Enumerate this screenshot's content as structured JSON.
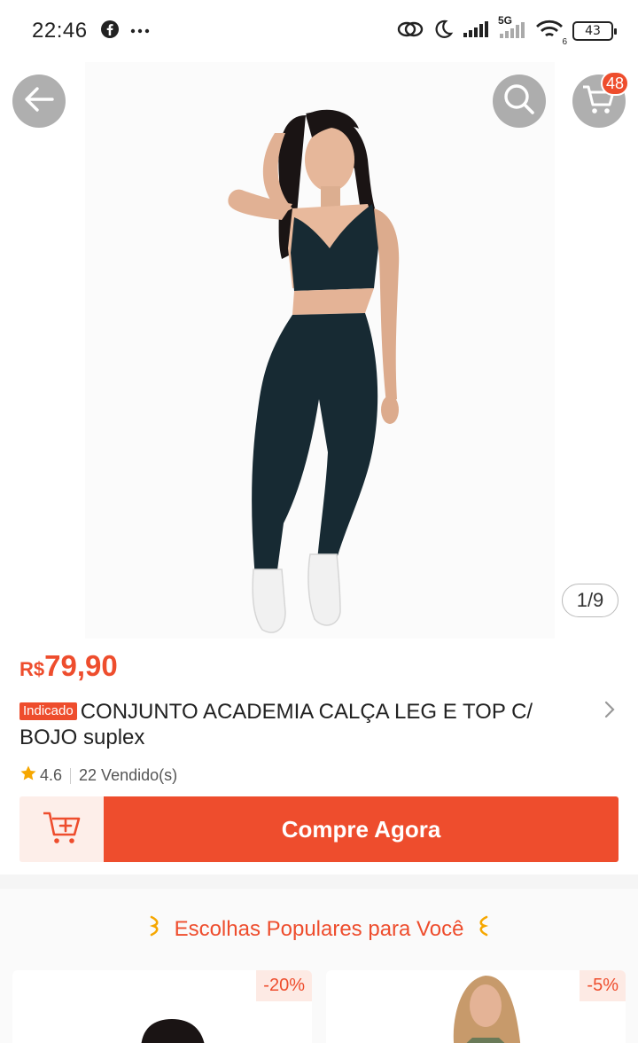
{
  "status_bar": {
    "time": "22:46",
    "left_icons": [
      "facebook-icon",
      "more-icon"
    ],
    "right_icons": [
      "link-icon",
      "moon-icon",
      "signal-icon",
      "5g-signal-icon",
      "wifi-icon",
      "battery-icon"
    ],
    "network_label": "5G",
    "wifi_label": "6",
    "battery": "43"
  },
  "header": {
    "back_icon": "back-arrow-icon",
    "search_icon": "search-icon",
    "cart_icon": "cart-icon",
    "cart_count": "48"
  },
  "gallery": {
    "indicator": "1/9",
    "image_description": "model"
  },
  "product": {
    "currency": "R$",
    "price": "79,90",
    "tag": "Indicado",
    "title": "CONJUNTO ACADEMIA CALÇA LEG E TOP C/ BOJO suplex",
    "rating": "4.6",
    "sold": "22 Vendido(s)"
  },
  "actions": {
    "buy_now": "Compre Agora"
  },
  "popular": {
    "title": "Escolhas Populares para Você",
    "cards": [
      {
        "discount": "-20%"
      },
      {
        "discount": "-5%"
      }
    ]
  },
  "colors": {
    "accent": "#ee4d2d",
    "accent_light": "#fdeee9",
    "leggings": "#172a33"
  }
}
